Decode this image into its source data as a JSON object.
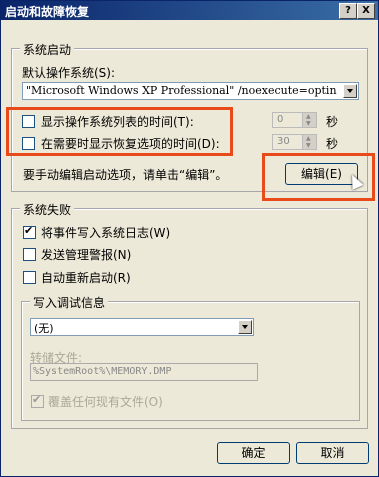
{
  "window": {
    "title": "启动和故障恢复",
    "help_btn": "?",
    "close_btn": "X"
  },
  "system_startup": {
    "group_label": "系统启动",
    "default_os_label": "默认操作系统(S):",
    "default_os_value": "\"Microsoft Windows XP Professional\" /noexecute=optin",
    "show_os_list": {
      "label": "显示操作系统列表的时间(T):",
      "checked": false,
      "value": "0",
      "unit": "秒"
    },
    "show_recovery": {
      "label": "在需要时显示恢复选项的时间(D):",
      "checked": false,
      "value": "30",
      "unit": "秒"
    },
    "edit_hint": "要手动编辑启动选项，请单击“编辑”。",
    "edit_button": "编辑(E)"
  },
  "system_failure": {
    "group_label": "系统失败",
    "write_event_log": {
      "label": "将事件写入系统日志(W)",
      "checked": true
    },
    "send_alert": {
      "label": "发送管理警报(N)",
      "checked": false
    },
    "auto_restart": {
      "label": "自动重新启动(R)",
      "checked": false
    }
  },
  "debug_info": {
    "group_label": "写入调试信息",
    "selected": "(无)",
    "dump_file_label": "转储文件:",
    "dump_file_value": "%SystemRoot%\\MEMORY.DMP",
    "overwrite": {
      "label": "覆盖任何现有文件(O)",
      "checked": true
    }
  },
  "buttons": {
    "ok": "确定",
    "cancel": "取消"
  },
  "colors": {
    "highlight": "#e84a1a",
    "titlebar": "#0a246a",
    "face": "#ece9d8"
  }
}
